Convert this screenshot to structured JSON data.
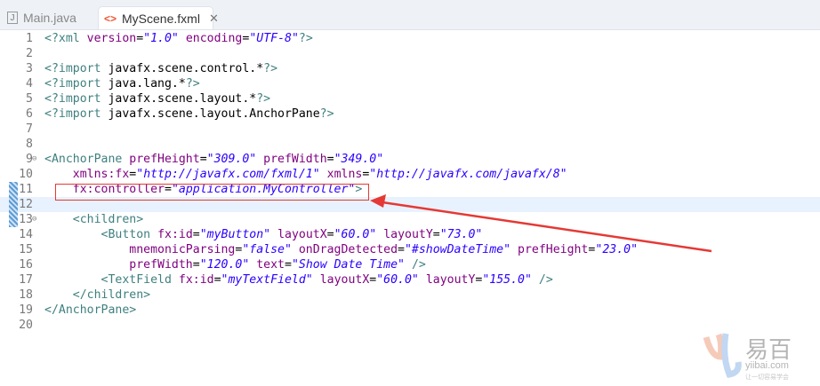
{
  "tabs": [
    {
      "label": "Main.java",
      "active": false
    },
    {
      "label": "MyScene.fxml",
      "active": true
    }
  ],
  "colors": {
    "tag": "#3f7f7f",
    "attr": "#7f007f",
    "value": "#2a00ff",
    "highlight": "#e8f2fe",
    "annotation": "#e53935"
  },
  "current_line": 12,
  "lines": [
    [
      [
        "t",
        "<?xml "
      ],
      [
        "a",
        "version"
      ],
      [
        "p",
        "="
      ],
      [
        "v",
        "\"1.0\""
      ],
      [
        "p",
        " "
      ],
      [
        "a",
        "encoding"
      ],
      [
        "p",
        "="
      ],
      [
        "v",
        "\"UTF-8\""
      ],
      [
        "t",
        "?>"
      ]
    ],
    [],
    [
      [
        "t",
        "<?import "
      ],
      [
        "p",
        "javafx.scene.control.*"
      ],
      [
        "t",
        "?>"
      ]
    ],
    [
      [
        "t",
        "<?import "
      ],
      [
        "p",
        "java.lang.*"
      ],
      [
        "t",
        "?>"
      ]
    ],
    [
      [
        "t",
        "<?import "
      ],
      [
        "p",
        "javafx.scene.layout.*"
      ],
      [
        "t",
        "?>"
      ]
    ],
    [
      [
        "t",
        "<?import "
      ],
      [
        "p",
        "javafx.scene.layout.AnchorPane"
      ],
      [
        "t",
        "?>"
      ]
    ],
    [],
    [],
    [
      [
        "t",
        "<AnchorPane "
      ],
      [
        "a",
        "prefHeight"
      ],
      [
        "p",
        "="
      ],
      [
        "v",
        "\"309.0\""
      ],
      [
        "p",
        " "
      ],
      [
        "a",
        "prefWidth"
      ],
      [
        "p",
        "="
      ],
      [
        "v",
        "\"349.0\""
      ]
    ],
    [
      [
        "p",
        "    "
      ],
      [
        "a",
        "xmlns:fx"
      ],
      [
        "p",
        "="
      ],
      [
        "v",
        "\"http://javafx.com/fxml/1\""
      ],
      [
        "p",
        " "
      ],
      [
        "a",
        "xmlns"
      ],
      [
        "p",
        "="
      ],
      [
        "v",
        "\"http://javafx.com/javafx/8\""
      ]
    ],
    [
      [
        "p",
        "    "
      ],
      [
        "a",
        "fx:controller"
      ],
      [
        "p",
        "="
      ],
      [
        "v",
        "\"application.MyController\""
      ],
      [
        "t",
        ">"
      ]
    ],
    [],
    [
      [
        "p",
        "    "
      ],
      [
        "t",
        "<children>"
      ]
    ],
    [
      [
        "p",
        "        "
      ],
      [
        "t",
        "<Button "
      ],
      [
        "a",
        "fx:id"
      ],
      [
        "p",
        "="
      ],
      [
        "v",
        "\"myButton\""
      ],
      [
        "p",
        " "
      ],
      [
        "a",
        "layoutX"
      ],
      [
        "p",
        "="
      ],
      [
        "v",
        "\"60.0\""
      ],
      [
        "p",
        " "
      ],
      [
        "a",
        "layoutY"
      ],
      [
        "p",
        "="
      ],
      [
        "v",
        "\"73.0\""
      ]
    ],
    [
      [
        "p",
        "            "
      ],
      [
        "a",
        "mnemonicParsing"
      ],
      [
        "p",
        "="
      ],
      [
        "v",
        "\"false\""
      ],
      [
        "p",
        " "
      ],
      [
        "a",
        "onDragDetected"
      ],
      [
        "p",
        "="
      ],
      [
        "v",
        "\"#showDateTime\""
      ],
      [
        "p",
        " "
      ],
      [
        "a",
        "prefHeight"
      ],
      [
        "p",
        "="
      ],
      [
        "v",
        "\"23.0\""
      ]
    ],
    [
      [
        "p",
        "            "
      ],
      [
        "a",
        "prefWidth"
      ],
      [
        "p",
        "="
      ],
      [
        "v",
        "\"120.0\""
      ],
      [
        "p",
        " "
      ],
      [
        "a",
        "text"
      ],
      [
        "p",
        "="
      ],
      [
        "v",
        "\"Show Date Time\""
      ],
      [
        "p",
        " "
      ],
      [
        "t",
        "/>"
      ]
    ],
    [
      [
        "p",
        "        "
      ],
      [
        "t",
        "<TextField "
      ],
      [
        "a",
        "fx:id"
      ],
      [
        "p",
        "="
      ],
      [
        "v",
        "\"myTextField\""
      ],
      [
        "p",
        " "
      ],
      [
        "a",
        "layoutX"
      ],
      [
        "p",
        "="
      ],
      [
        "v",
        "\"60.0\""
      ],
      [
        "p",
        " "
      ],
      [
        "a",
        "layoutY"
      ],
      [
        "p",
        "="
      ],
      [
        "v",
        "\"155.0\""
      ],
      [
        "p",
        " "
      ],
      [
        "t",
        "/>"
      ]
    ],
    [
      [
        "p",
        "    "
      ],
      [
        "t",
        "</children>"
      ]
    ],
    [
      [
        "t",
        "</AnchorPane>"
      ]
    ],
    []
  ],
  "fold_lines": [
    9,
    13
  ],
  "changed_lines": [
    11,
    12,
    13
  ],
  "watermark": {
    "name": "易百",
    "domain": "yiibai.com",
    "slogan": "让一切容易学会"
  }
}
